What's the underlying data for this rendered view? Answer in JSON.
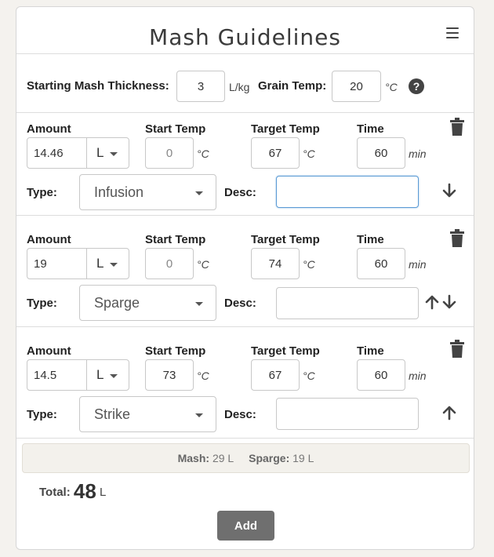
{
  "title": "Mash Guidelines",
  "settings": {
    "thickness_label": "Starting Mash Thickness:",
    "thickness_value": "3",
    "thickness_unit": "L/kg",
    "grain_temp_label": "Grain Temp:",
    "grain_temp_value": "20",
    "grain_temp_unit": "°C",
    "help_glyph": "?"
  },
  "labels": {
    "amount": "Amount",
    "start_temp": "Start Temp",
    "target_temp": "Target Temp",
    "time": "Time",
    "type": "Type:",
    "desc": "Desc:",
    "temp_unit": "°C",
    "time_unit": "min"
  },
  "steps": [
    {
      "amount": "14.46",
      "amount_unit": "L",
      "start_temp": "0",
      "target_temp": "67",
      "time": "60",
      "type": "Infusion",
      "desc": ""
    },
    {
      "amount": "19",
      "amount_unit": "L",
      "start_temp": "0",
      "target_temp": "74",
      "time": "60",
      "type": "Sparge",
      "desc": ""
    },
    {
      "amount": "14.5",
      "amount_unit": "L",
      "start_temp": "73",
      "target_temp": "67",
      "time": "60",
      "type": "Strike",
      "desc": ""
    }
  ],
  "summary": {
    "mash_label": "Mash:",
    "mash_value": "29 L",
    "sparge_label": "Sparge:",
    "sparge_value": "19 L"
  },
  "total": {
    "label": "Total:",
    "value": "48",
    "unit": "L"
  },
  "add_label": "Add"
}
